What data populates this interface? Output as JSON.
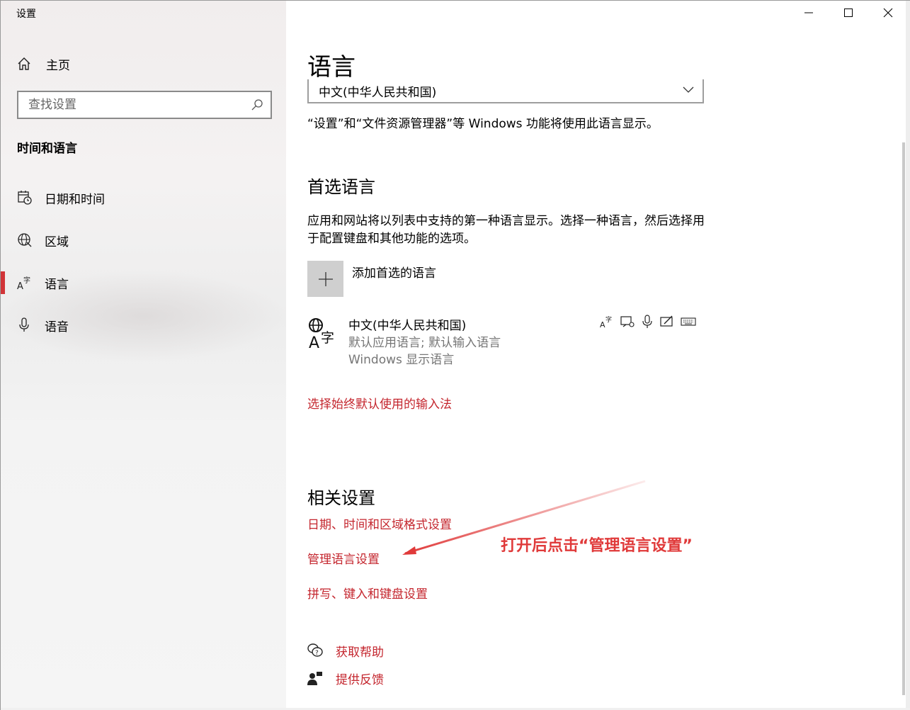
{
  "window": {
    "title": "设置"
  },
  "sidebar": {
    "home_label": "主页",
    "search_placeholder": "查找设置",
    "section_title": "时间和语言",
    "items": [
      {
        "label": "日期和时间",
        "icon": "calendar-clock-icon",
        "active": false
      },
      {
        "label": "区域",
        "icon": "globe-region-icon",
        "active": false
      },
      {
        "label": "语言",
        "icon": "language-icon",
        "active": true
      },
      {
        "label": "语音",
        "icon": "microphone-icon",
        "active": false
      }
    ]
  },
  "main": {
    "title": "语言",
    "display_language_value": "中文(中华人民共和国)",
    "display_language_desc": "“设置”和“文件资源管理器”等 Windows 功能将使用此语言显示。",
    "preferred": {
      "heading": "首选语言",
      "desc": "应用和网站将以列表中支持的第一种语言显示。选择一种语言，然后选择用于配置键盘和其他功能的选项。",
      "add_label": "添加首选的语言",
      "language": {
        "name": "中文(中华人民共和国)",
        "sub1": "默认应用语言; 默认输入语言",
        "sub2": "Windows 显示语言",
        "features": [
          "language-pack-icon",
          "text-to-speech-icon",
          "microphone-icon",
          "handwriting-icon",
          "keyboard-icon"
        ]
      },
      "input_method_link": "选择始终默认使用的输入法"
    },
    "related": {
      "heading": "相关设置",
      "links": [
        "日期、时间和区域格式设置",
        "管理语言设置",
        "拼写、键入和键盘设置"
      ]
    },
    "help": {
      "get_help": "获取帮助",
      "feedback": "提供反馈"
    },
    "annotation": "打开后点击“管理语言设置”"
  },
  "colors": {
    "accent": "#c4262e",
    "annotation": "#e03a3a",
    "active_indicator": "#d13438"
  }
}
